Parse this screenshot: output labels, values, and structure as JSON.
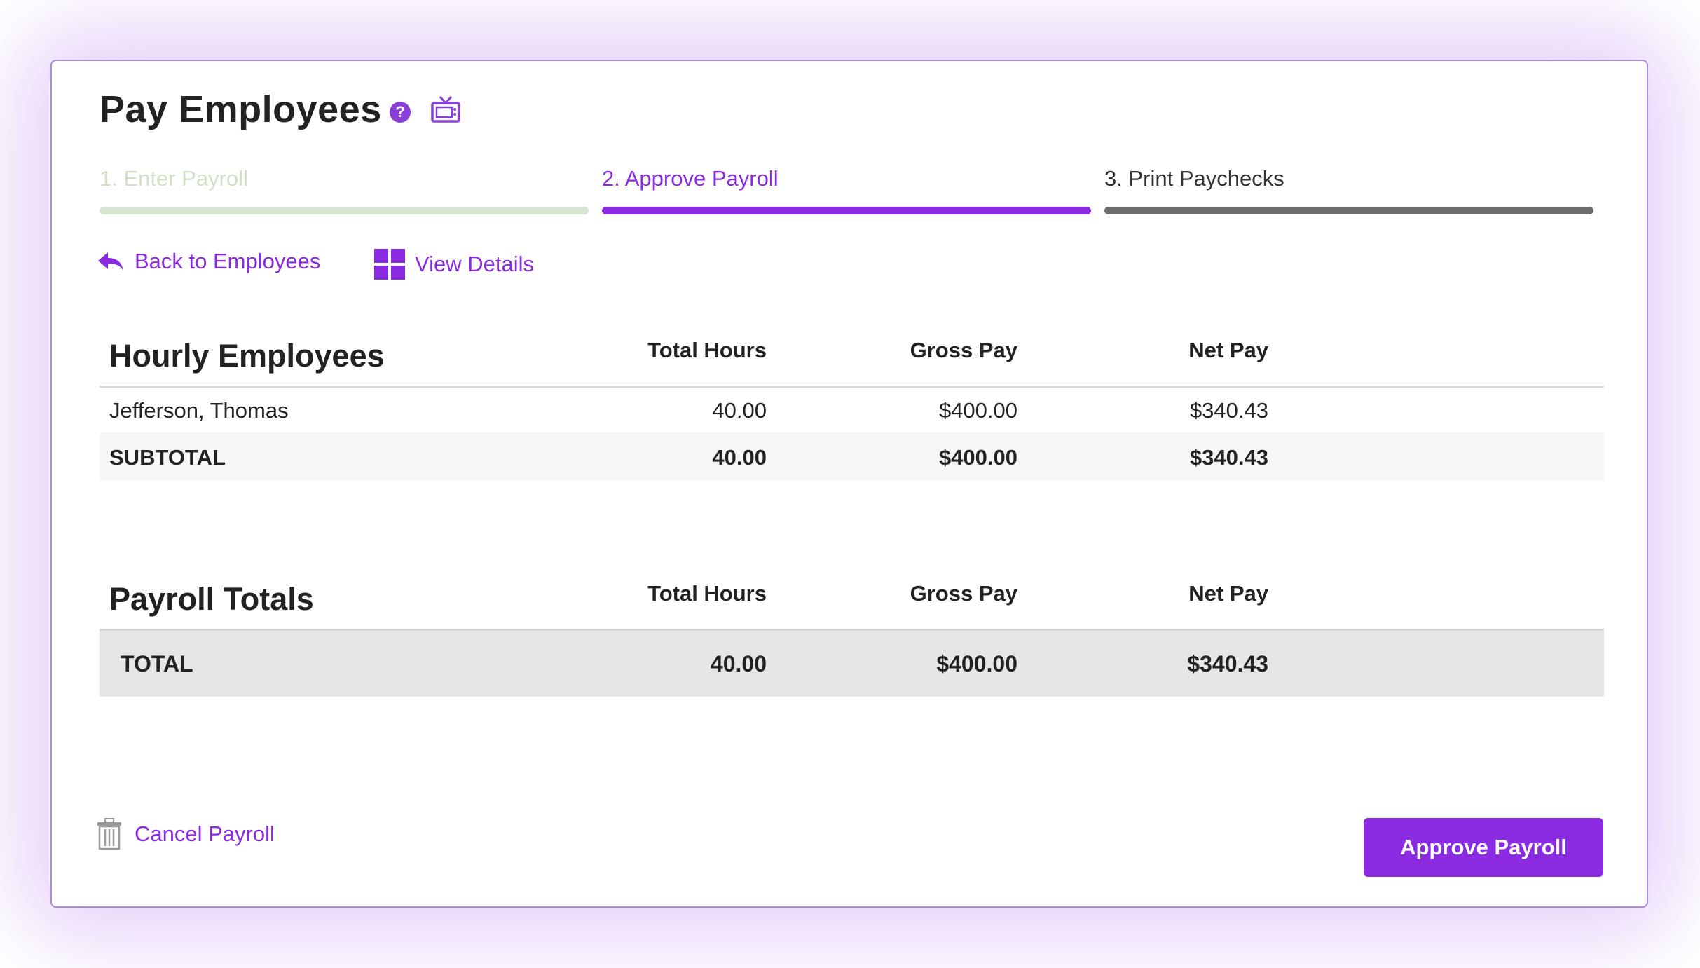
{
  "header": {
    "title": "Pay Employees",
    "help_icon": "question-circle-icon",
    "help_glyph": "?",
    "video_icon": "tv-icon"
  },
  "steps": [
    {
      "label": "1. Enter Payroll",
      "state": "complete"
    },
    {
      "label": "2. Approve Payroll",
      "state": "active"
    },
    {
      "label": "3. Print Paychecks",
      "state": "upcoming"
    }
  ],
  "nav": {
    "back_label": "Back to Employees",
    "details_label": "View Details"
  },
  "hourly": {
    "title": "Hourly Employees",
    "columns": [
      "Total Hours",
      "Gross Pay",
      "Net Pay"
    ],
    "rows": [
      {
        "name": "Jefferson, Thomas",
        "hours": "40.00",
        "gross": "$400.00",
        "net": "$340.43"
      }
    ],
    "subtotal": {
      "label": "SUBTOTAL",
      "hours": "40.00",
      "gross": "$400.00",
      "net": "$340.43"
    }
  },
  "totals": {
    "title": "Payroll Totals",
    "columns": [
      "Total Hours",
      "Gross Pay",
      "Net Pay"
    ],
    "total": {
      "label": "TOTAL",
      "hours": "40.00",
      "gross": "$400.00",
      "net": "$340.43"
    }
  },
  "footer": {
    "cancel_label": "Cancel Payroll",
    "approve_label": "Approve Payroll"
  },
  "colors": {
    "accent": "#8a2be2",
    "step_complete": "#d6e5cf",
    "step_upcoming": "#6e6e6e",
    "border": "#a98be0"
  }
}
